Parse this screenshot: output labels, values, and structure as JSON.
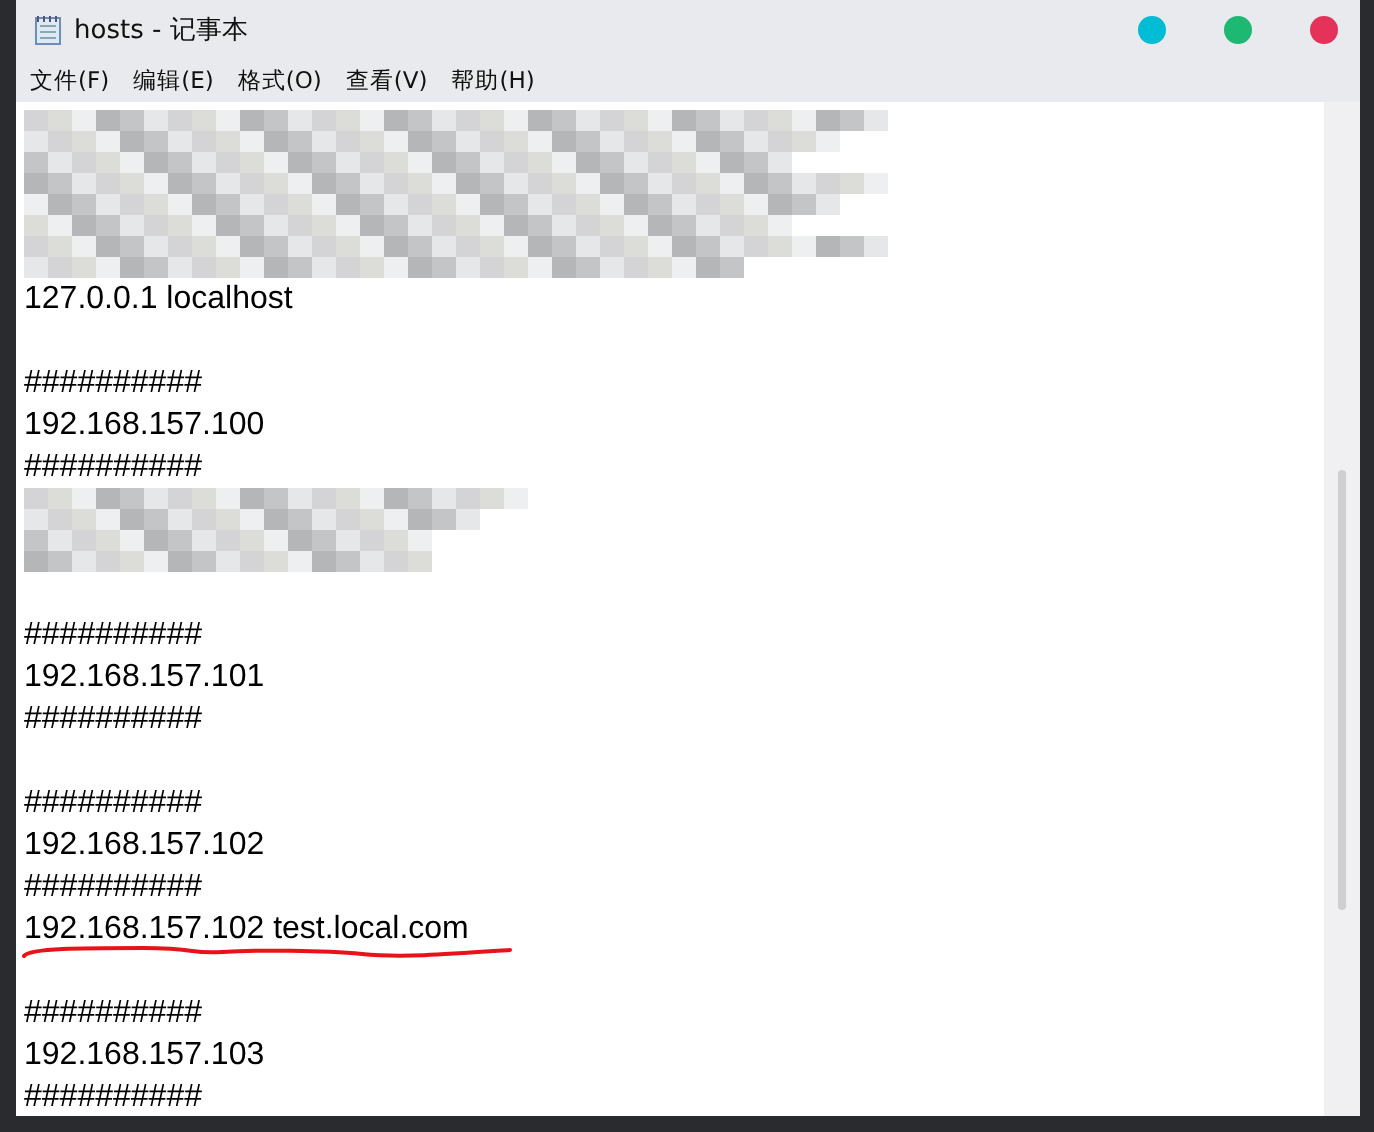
{
  "window": {
    "title": "hosts - 记事本"
  },
  "window_buttons": [
    {
      "color": "#00bcd4"
    },
    {
      "color": "#1db872"
    },
    {
      "color": "#e5325a"
    }
  ],
  "menu": [
    "文件(F)",
    "编辑(E)",
    "格式(O)",
    "查看(V)",
    "帮助(H)"
  ],
  "lines": [
    {
      "kind": "redacted"
    },
    {
      "kind": "text",
      "text": "127.0.0.1 localhost"
    },
    {
      "kind": "blank"
    },
    {
      "kind": "text",
      "text": "##########"
    },
    {
      "kind": "text",
      "text": "192.168.157.100"
    },
    {
      "kind": "text",
      "text": "##########"
    },
    {
      "kind": "redacted"
    },
    {
      "kind": "blank"
    },
    {
      "kind": "text",
      "text": "##########"
    },
    {
      "kind": "text",
      "text": "192.168.157.101"
    },
    {
      "kind": "text",
      "text": "##########"
    },
    {
      "kind": "blank"
    },
    {
      "kind": "text",
      "text": "##########"
    },
    {
      "kind": "text",
      "text": "192.168.157.102"
    },
    {
      "kind": "text",
      "text": "##########"
    },
    {
      "kind": "text",
      "text": "192.168.157.102 test.local.com",
      "underlined": true
    },
    {
      "kind": "blank"
    },
    {
      "kind": "text",
      "text": "##########"
    },
    {
      "kind": "text",
      "text": "192.168.157.103"
    },
    {
      "kind": "text",
      "text": "##########"
    }
  ]
}
